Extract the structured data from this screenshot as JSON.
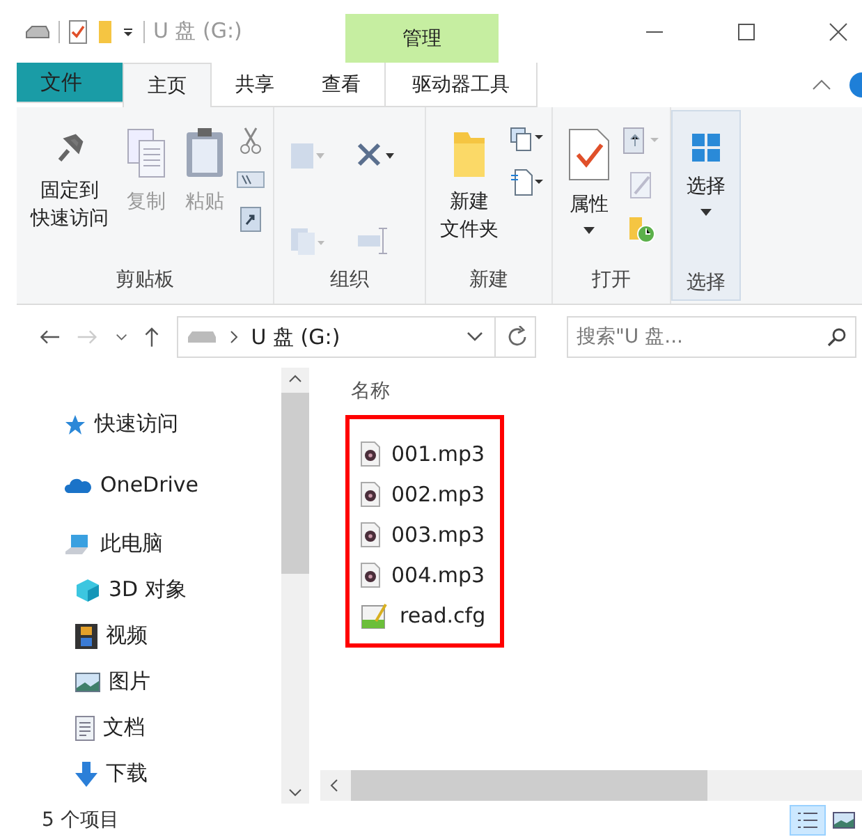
{
  "title_bar": {
    "title": "U 盘 (G:)",
    "context_tab": "管理"
  },
  "tabs": [
    {
      "label": "文件",
      "kind": "file",
      "selected": false
    },
    {
      "label": "主页",
      "kind": "tab",
      "selected": true
    },
    {
      "label": "共享",
      "kind": "tab",
      "selected": false
    },
    {
      "label": "查看",
      "kind": "tab",
      "selected": false
    },
    {
      "label": "驱动器工具",
      "kind": "context",
      "selected": false
    }
  ],
  "ribbon": [
    {
      "label": "剪贴板",
      "buttons": [
        {
          "lines": [
            "固定到",
            "快速访问"
          ],
          "disabled": false
        },
        {
          "lines": [
            "复制"
          ],
          "disabled": true
        },
        {
          "lines": [
            "粘贴"
          ],
          "disabled": true
        }
      ]
    },
    {
      "label": "组织"
    },
    {
      "label": "新建",
      "buttons": [
        {
          "lines": [
            "新建",
            "文件夹"
          ],
          "disabled": false
        }
      ]
    },
    {
      "label": "打开",
      "buttons": [
        {
          "lines": [
            "属性"
          ],
          "disabled": false
        }
      ]
    },
    {
      "label": "选择",
      "buttons": [
        {
          "lines": [
            "选择"
          ],
          "disabled": false
        }
      ]
    }
  ],
  "address": {
    "path": "U 盘 (G:)",
    "search_placeholder": "搜索\"U 盘..."
  },
  "nav": [
    {
      "label": "快速访问"
    },
    {
      "label": "OneDrive"
    },
    {
      "label": "此电脑",
      "children": [
        {
          "label": "3D 对象"
        },
        {
          "label": "视频"
        },
        {
          "label": "图片"
        },
        {
          "label": "文档"
        },
        {
          "label": "下载"
        }
      ]
    }
  ],
  "content": {
    "column": "名称",
    "highlighted": true,
    "files": [
      {
        "name": "001.mp3",
        "kind": "audio"
      },
      {
        "name": "002.mp3",
        "kind": "audio"
      },
      {
        "name": "003.mp3",
        "kind": "audio"
      },
      {
        "name": "004.mp3",
        "kind": "audio"
      },
      {
        "name": "read.cfg",
        "kind": "config"
      }
    ]
  },
  "status_bar": {
    "count": "5 个项目",
    "views": [
      {
        "kind": "details",
        "selected": true
      },
      {
        "kind": "tiles",
        "selected": false
      }
    ]
  }
}
